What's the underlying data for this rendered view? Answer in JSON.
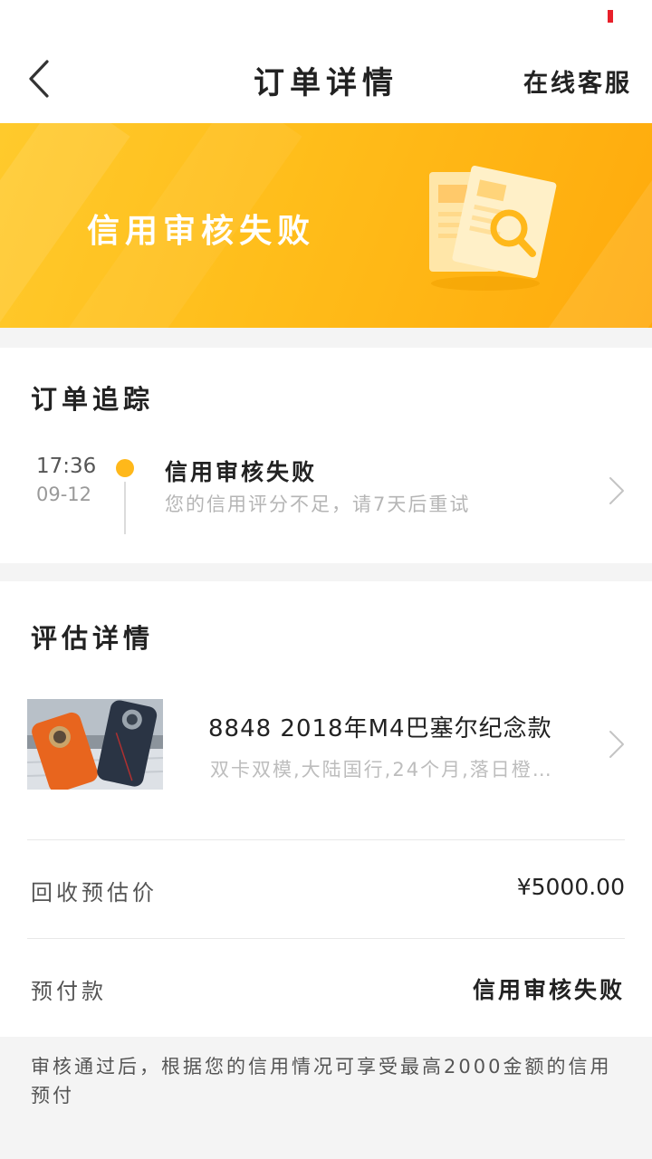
{
  "header": {
    "title": "订单详情",
    "service_label": "在线客服",
    "back_icon": "chevron-left-icon"
  },
  "banner": {
    "status_text": "信用审核失败",
    "illustration": "document-search-icon",
    "accent": "#ffb81a"
  },
  "tracking": {
    "title": "订单追踪",
    "entries": [
      {
        "time": "17:36",
        "date": "09-12",
        "status": "信用审核失败",
        "description": "您的信用评分不足，请7天后重试"
      }
    ]
  },
  "evaluation": {
    "title": "评估详情",
    "product": {
      "name": "8848 2018年M4巴塞尔纪念款",
      "spec": "双卡双模,大陆国行,24个月,落日橙…"
    },
    "rows": [
      {
        "label": "回收预估价",
        "value": "¥5000.00"
      },
      {
        "label": "预付款",
        "value": "信用审核失败"
      }
    ]
  },
  "footer_note": "审核通过后，根据您的信用情况可享受最高2000金额的信用预付"
}
